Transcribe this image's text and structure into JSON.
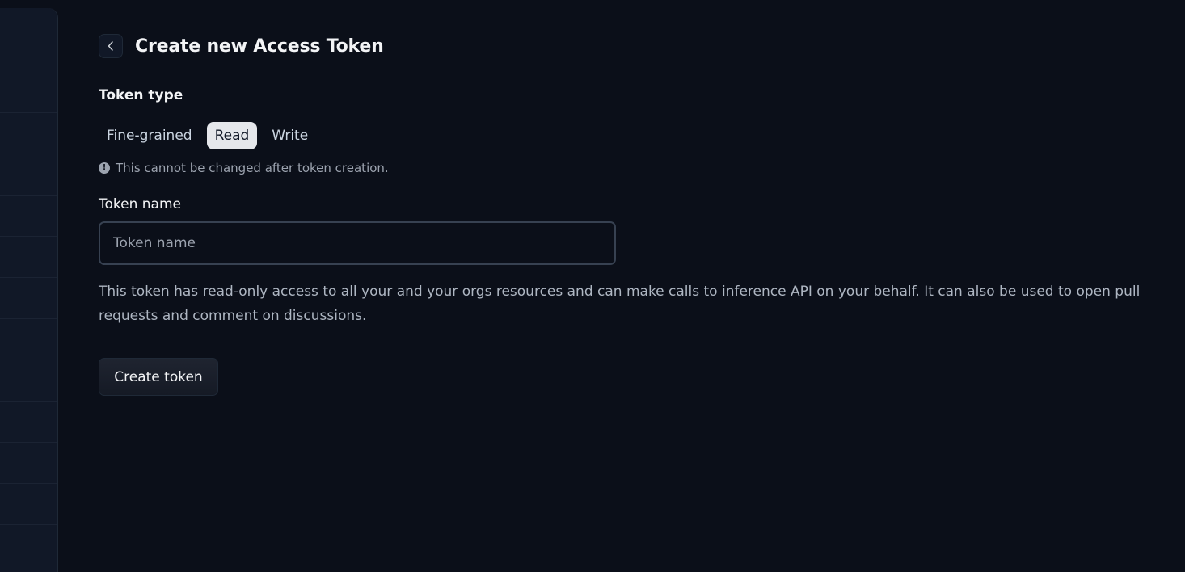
{
  "header": {
    "back_icon": "chevron-left-icon",
    "title": "Create new Access Token"
  },
  "token_type": {
    "label": "Token type",
    "options": [
      "Fine-grained",
      "Read",
      "Write"
    ],
    "selected": "Read",
    "hint_icon": "exclamation-circle-icon",
    "hint": "This cannot be changed after token creation."
  },
  "token_name": {
    "label": "Token name",
    "placeholder": "Token name",
    "value": ""
  },
  "description": "This token has read-only access to all your and your orgs resources and can make calls to inference API on your behalf. It can also be used to open pull requests and comment on discussions.",
  "actions": {
    "create_label": "Create token"
  },
  "colors": {
    "background": "#0b0f19",
    "sidebar": "#111827",
    "selected_bg": "#e5e7eb",
    "text_primary": "#f3f4f6",
    "text_muted": "#9ca3af"
  }
}
